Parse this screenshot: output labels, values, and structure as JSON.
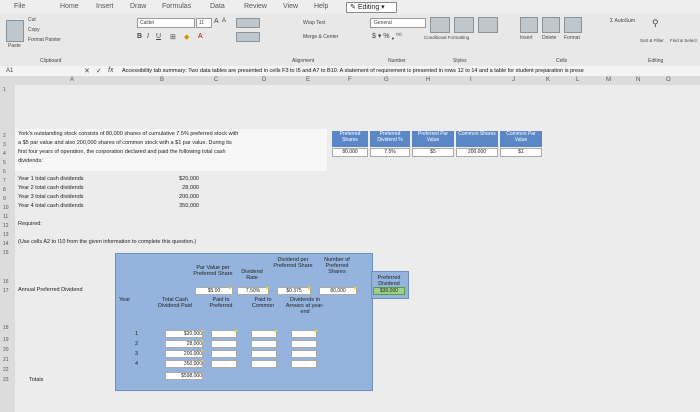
{
  "tabs": [
    "File",
    "Home",
    "Insert",
    "Draw",
    "Formulas",
    "Data",
    "Review",
    "View",
    "Help"
  ],
  "editing_label": "Editing",
  "ribbon": {
    "cut": "Cut",
    "copy": "Copy",
    "format_painter": "Format Painter",
    "paste": "Paste",
    "clipboard": "Clipboard",
    "font_name": "Calibri",
    "font_size": "11",
    "wrap_text": "Wrap Text",
    "merge_center": "Merge & Center",
    "alignment": "Alignment",
    "number_format": "General",
    "number": "Number",
    "conditional": "Conditional Formatting",
    "format_as": "Format As Table",
    "styles": "Styles",
    "insert": "Insert",
    "delete": "Delete",
    "format": "Format",
    "cells": "Cells",
    "autosum": "AutoSum",
    "sort": "Sort & Filter",
    "find": "Find & Select",
    "editing": "Editing"
  },
  "formula_bar": {
    "cell_ref": "A1",
    "content": "Accessibility tab summary: Two data tables are presented in cells F3 to I5 and A7 to B10. A statement of requirement is presented in rows 12 to 14 and a table for student preparation is prese"
  },
  "columns": [
    "A",
    "B",
    "C",
    "D",
    "E",
    "F",
    "G",
    "H",
    "I",
    "J",
    "K",
    "L",
    "M",
    "N",
    "O"
  ],
  "rows": [
    "1",
    "2",
    "3",
    "4",
    "5",
    "6",
    "7",
    "8",
    "9",
    "10",
    "11",
    "12",
    "13",
    "14",
    "15",
    "16",
    "17",
    "18",
    "19",
    "20",
    "21",
    "22",
    "23"
  ],
  "intro": [
    "York's outstanding stock consists of 80,000 shares of cumulative 7.5% preferred stock with",
    "a $5 par value and also 200,000 shares of common stock with a $1 par value. During its",
    "first four years of operation, the corporation declared and paid the following total cash",
    "dividends:"
  ],
  "top_table": {
    "headers": [
      "Preferred Shares",
      "Preferred Dividend %",
      "Preferred Par Value",
      "Common Shares",
      "Common Par Value"
    ],
    "values": [
      "80,000",
      "7.5%",
      "$5",
      "200,000",
      "$1"
    ]
  },
  "dividends": [
    {
      "label": "Year 1 total cash dividends",
      "value": "$20,000"
    },
    {
      "label": "Year 2 total cash dividends",
      "value": "28,000"
    },
    {
      "label": "Year 3 total cash dividends",
      "value": "200,000"
    },
    {
      "label": "Year 4 total cash dividends",
      "value": "350,000"
    }
  ],
  "required": "Required:",
  "instruction": "(Use cells A2 to I10 from the given information to complete this question.)",
  "prep": {
    "row_label": "Annual Preferred Dividend",
    "top_headers": [
      "Par Value per Preferred Share",
      "Dividend Rate",
      "Dividend per Preferred Share",
      "Number of Preferred Shares",
      "Preferred Dividend"
    ],
    "top_values": [
      "$5.00",
      "7.50%",
      "$0.375",
      "80,000",
      "$30,000"
    ],
    "year_header": "Year",
    "sub_headers": [
      "Total Cash Dividend Paid",
      "Paid to Preferred",
      "Paid to Common",
      "Dividends in Arrears at year-end"
    ],
    "years": [
      "1",
      "2",
      "3",
      "4"
    ],
    "totals_cash": [
      "$20,000",
      "28,000",
      "200,000",
      "350,000"
    ],
    "total_sum": "$598,000",
    "totals_label": "Totals"
  }
}
